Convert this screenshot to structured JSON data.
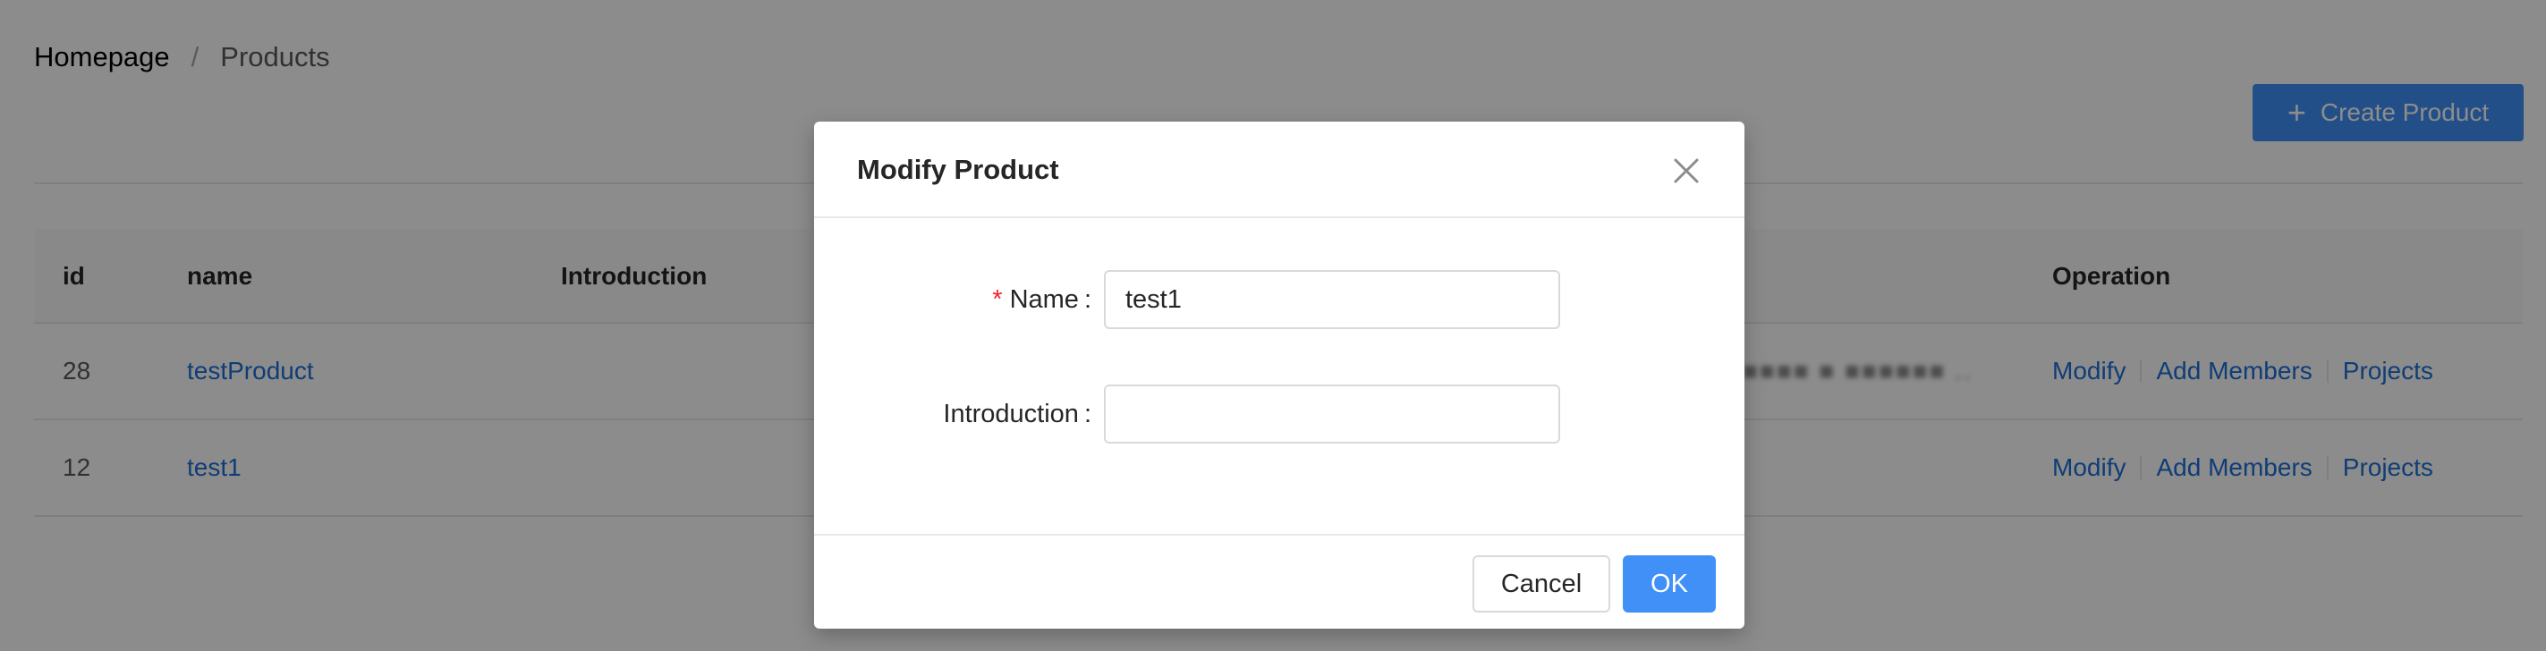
{
  "breadcrumb": {
    "home": "Homepage",
    "separator": "/",
    "current": "Products"
  },
  "toolbar": {
    "create_label": "Create Product",
    "create_icon": "plus-icon"
  },
  "table": {
    "columns": {
      "id": "id",
      "name": "name",
      "introduction": "Introduction",
      "operation": "Operation"
    },
    "rows": [
      {
        "id": "28",
        "name": "testProduct",
        "introduction": "",
        "blurred": "■■■■ ■ ■■■■■■ ..",
        "ops": [
          "Modify",
          "Add Members",
          "Projects"
        ]
      },
      {
        "id": "12",
        "name": "test1",
        "introduction": "",
        "blurred": "",
        "ops": [
          "Modify",
          "Add Members",
          "Projects"
        ]
      }
    ]
  },
  "modal": {
    "title": "Modify Product",
    "close_icon": "close-icon",
    "fields": {
      "name": {
        "required_mark": "*",
        "label": "Name",
        "colon": ":",
        "value": "test1",
        "placeholder": ""
      },
      "introduction": {
        "label": "Introduction",
        "colon": ":",
        "value": "",
        "placeholder": ""
      }
    },
    "cancel_label": "Cancel",
    "ok_label": "OK"
  },
  "colors": {
    "primary": "#4090f7",
    "link": "#1d6fd8",
    "required": "#f5222d",
    "mask": "rgba(0,0,0,0.45)"
  }
}
